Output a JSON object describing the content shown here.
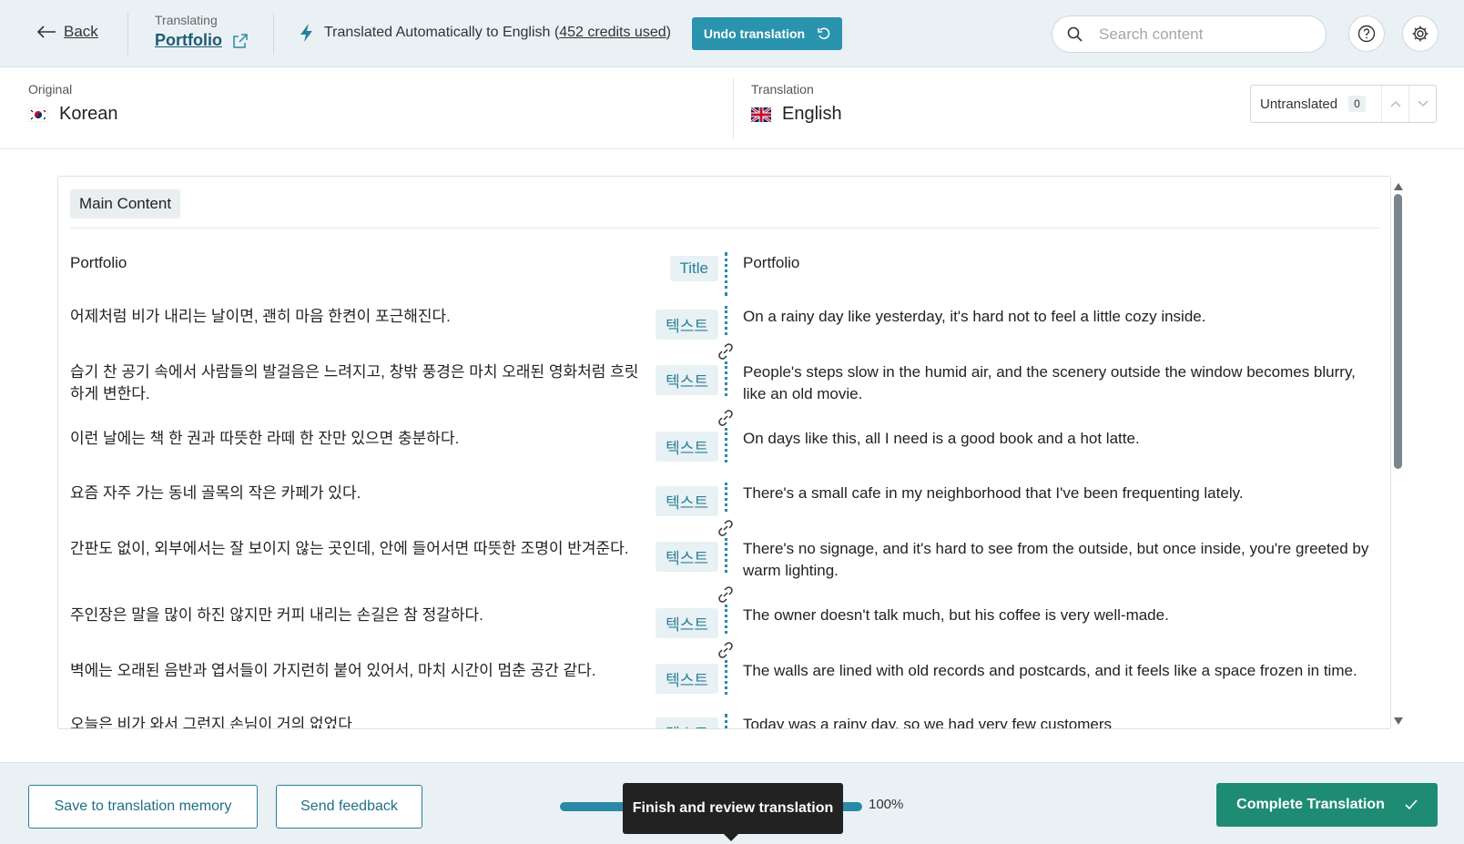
{
  "header": {
    "back_label": "Back",
    "translating_label": "Translating",
    "project_name": "Portfolio",
    "auto_text_prefix": "Translated Automatically to English (",
    "credits_text": "452 credits used",
    "auto_text_suffix": ")",
    "undo_label": "Undo translation",
    "search_placeholder": "Search content"
  },
  "languages": {
    "original_label": "Original",
    "original_name": "Korean",
    "translation_label": "Translation",
    "translation_name": "English",
    "untranslated_label": "Untranslated",
    "untranslated_count": "0"
  },
  "content": {
    "section_label": "Main Content",
    "segments": [
      {
        "source": "Portfolio",
        "tag": "Title",
        "target": "Portfolio"
      },
      {
        "source": "어제처럼 비가 내리는 날이면, 괜히 마음 한켠이 포근해진다.",
        "tag": "텍스트",
        "target": "On a rainy day like yesterday, it's hard not to feel a little cozy inside."
      },
      {
        "source": "습기 찬 공기 속에서 사람들의 발걸음은 느려지고, 창밖 풍경은 마치 오래된 영화처럼 흐릿하게 변한다.",
        "tag": "텍스트",
        "target": "People's steps slow in the humid air, and the scenery outside the window becomes blurry, like an old movie."
      },
      {
        "source": "이런 날에는 책 한 권과 따뜻한 라떼 한 잔만 있으면 충분하다.",
        "tag": "텍스트",
        "target": "On days like this, all I need is a good book and a hot latte."
      },
      {
        "source": "요즘 자주 가는 동네 골목의 작은 카페가 있다.",
        "tag": "텍스트",
        "target": "There's a small cafe in my neighborhood that I've been frequenting lately."
      },
      {
        "source": "간판도 없이, 외부에서는 잘 보이지 않는 곳인데, 안에 들어서면 따뜻한 조명이 반겨준다.",
        "tag": "텍스트",
        "target": "There's no signage, and it's hard to see from the outside, but once inside, you're greeted by warm lighting."
      },
      {
        "source": "주인장은 말을 많이 하진 않지만 커피 내리는 손길은 참 정갈하다.",
        "tag": "텍스트",
        "target": "The owner doesn't talk much, but his coffee is very well-made."
      },
      {
        "source": "벽에는 오래된 음반과 엽서들이 가지런히 붙어 있어서, 마치 시간이 멈춘 공간 같다.",
        "tag": "텍스트",
        "target": "The walls are lined with old records and postcards, and it feels like a space frozen in time."
      },
      {
        "source": "오늘은 비가 와서 그런지 손님이 거의 없었다",
        "tag": "텍스트",
        "target": "Today was a rainy day, so we had very few customers"
      }
    ]
  },
  "footer": {
    "save_memory_label": "Save to translation memory",
    "feedback_label": "Send feedback",
    "progress_percent": 100,
    "progress_text": "100%",
    "tooltip_text": "Finish and review translation",
    "complete_label": "Complete Translation"
  },
  "colors": {
    "accent": "#2a93ae",
    "complete": "#1e8c74",
    "header_bg": "#eaf1f5"
  },
  "icons": [
    "back-arrow-icon",
    "external-link-icon",
    "lightning-icon",
    "undo-icon",
    "search-icon",
    "help-icon",
    "gear-icon",
    "korea-flag-icon",
    "uk-flag-icon",
    "chevron-up-icon",
    "chevron-down-icon",
    "link-icon",
    "checkmark-icon"
  ]
}
